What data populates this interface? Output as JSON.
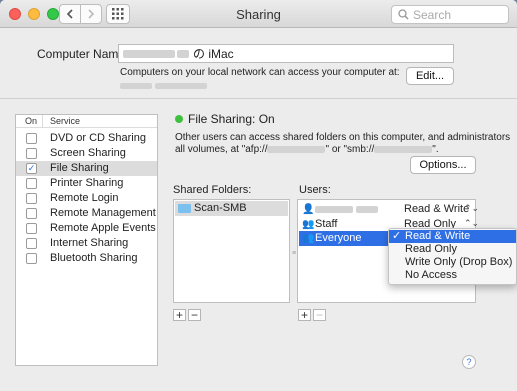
{
  "window": {
    "title": "Sharing",
    "search_placeholder": "Search",
    "colors": {
      "close": "#fc605b",
      "minimize": "#fdbc40",
      "zoom": "#34c84a",
      "selection": "#2f6fe6",
      "status_on": "#3fc13f"
    }
  },
  "computer_name": {
    "label": "Computer Name:",
    "value_suffix": "の iMac",
    "info": "Computers on your local network can access your computer at:",
    "edit_button": "Edit..."
  },
  "services": {
    "col_on": "On",
    "col_service": "Service",
    "items": [
      {
        "label": "DVD or CD Sharing",
        "checked": false
      },
      {
        "label": "Screen Sharing",
        "checked": false
      },
      {
        "label": "File Sharing",
        "checked": true,
        "selected": true
      },
      {
        "label": "Printer Sharing",
        "checked": false
      },
      {
        "label": "Remote Login",
        "checked": false
      },
      {
        "label": "Remote Management",
        "checked": false
      },
      {
        "label": "Remote Apple Events",
        "checked": false
      },
      {
        "label": "Internet Sharing",
        "checked": false
      },
      {
        "label": "Bluetooth Sharing",
        "checked": false
      }
    ]
  },
  "file_sharing": {
    "status": "File Sharing: On",
    "desc_line1": "Other users can access shared folders on this computer, and administrators",
    "desc_line2_a": "all volumes, at \"afp://",
    "desc_line2_b": "\" or \"smb://",
    "desc_line2_c": "\".",
    "options_button": "Options...",
    "shared_folders_label": "Shared Folders:",
    "users_label": "Users:",
    "folders": [
      "Scan-SMB"
    ],
    "users": [
      {
        "icon": "person-icon",
        "name": "",
        "permission": "Read & Write"
      },
      {
        "icon": "group-icon",
        "name": "Staff",
        "permission": "Read Only"
      },
      {
        "icon": "everyone-icon",
        "name": "Everyone",
        "permission": ""
      }
    ],
    "add_label": "+",
    "remove_label": "−"
  },
  "permission_menu": {
    "selected": "Read & Write",
    "options": [
      "Read & Write",
      "Read Only",
      "Write Only (Drop Box)",
      "No Access"
    ]
  },
  "help_label": "?"
}
